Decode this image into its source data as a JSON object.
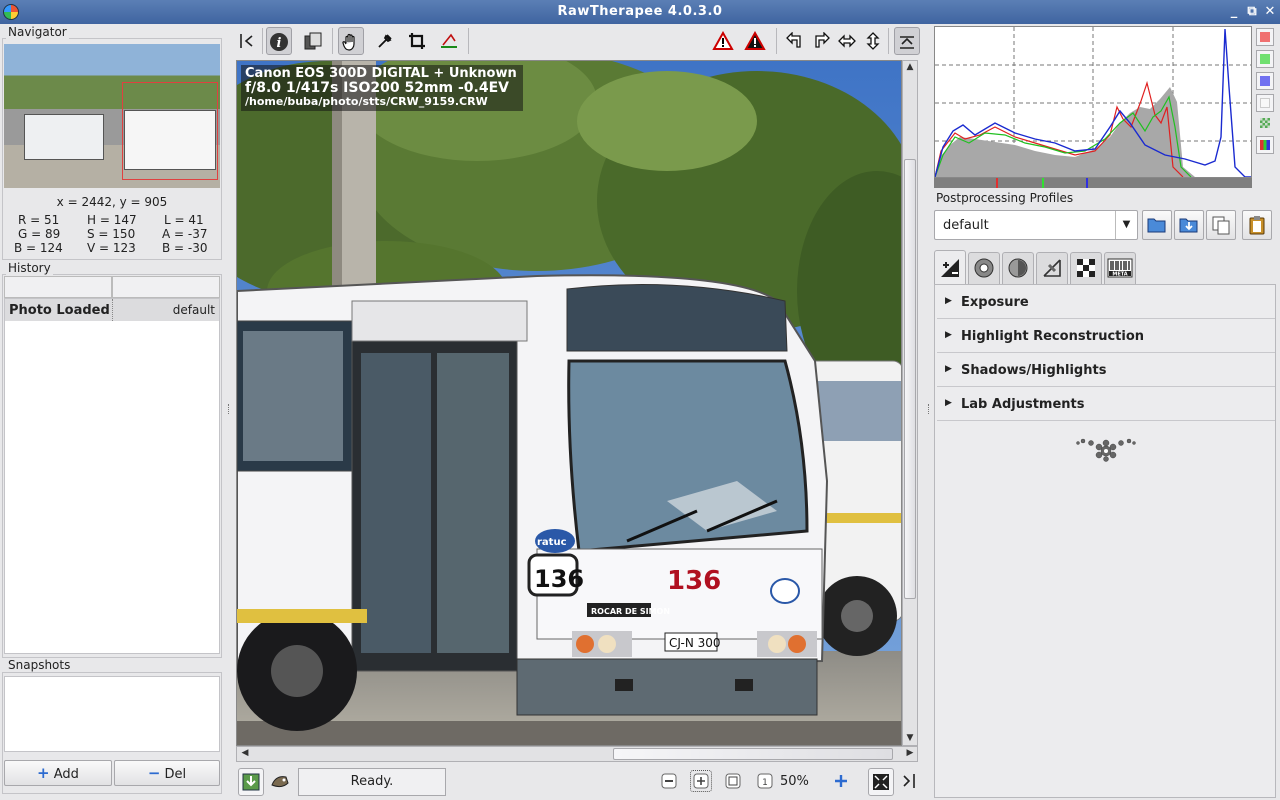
{
  "window": {
    "title": "RawTherapee 4.0.3.0",
    "controls": [
      "_",
      "⧉",
      "✕"
    ]
  },
  "navigator": {
    "label": "Navigator",
    "coords": "x = 2442, y = 905",
    "values": {
      "r": "R = 51",
      "g": "G = 89",
      "b": "B = 124",
      "h": "H = 147",
      "s": "S = 150",
      "v": "V = 123",
      "l": "L = 41",
      "a": "A = -37",
      "lb": "B = -30"
    }
  },
  "history": {
    "label": "History",
    "rows": [
      {
        "action": "Photo Loaded",
        "value": "default"
      }
    ]
  },
  "snapshots": {
    "label": "Snapshots",
    "add_label": "Add",
    "del_label": "Del"
  },
  "image_info": {
    "camera": "Canon EOS 300D DIGITAL + Unknown",
    "exposure": "f/8.0  1/417s  ISO200  52mm  -0.4EV",
    "path": "/home/buba/photo/stts/CRW_9159.CRW"
  },
  "statusbar": {
    "status": "Ready.",
    "zoom": "50%"
  },
  "profiles": {
    "label": "Postprocessing Profiles",
    "selected": "default"
  },
  "tools": {
    "sections": [
      {
        "label": "Exposure"
      },
      {
        "label": "Highlight Reconstruction"
      },
      {
        "label": "Shadows/Highlights"
      },
      {
        "label": "Lab Adjustments"
      }
    ]
  },
  "bus": {
    "number": "136",
    "plate": "CJ-N 300",
    "sign": "ROCAR DE SIMON",
    "logo": "ratuc"
  },
  "colors": {
    "titlebar": "#4a6fa8",
    "histogram_red": "#e02020",
    "histogram_green": "#20c020",
    "histogram_blue": "#1a2ad0"
  }
}
